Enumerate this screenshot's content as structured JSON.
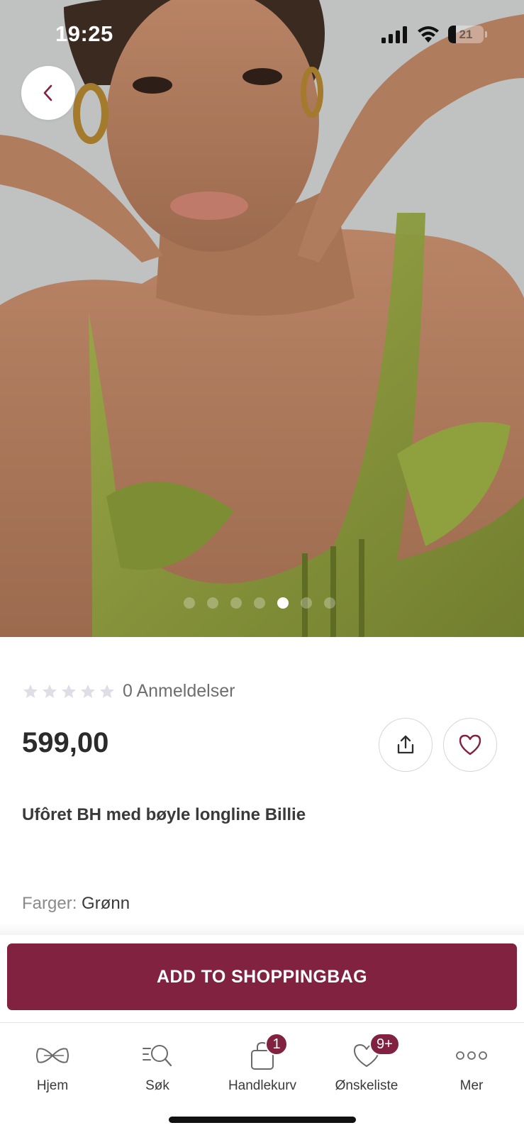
{
  "status_bar": {
    "time": "19:25",
    "battery_percent": "21",
    "icons": [
      "signal-icon",
      "wifi-icon",
      "battery-icon"
    ]
  },
  "gallery": {
    "image_count": 7,
    "active_index": 4,
    "back_icon": "chevron-left-icon"
  },
  "product": {
    "rating_stars": 0,
    "reviews_label": "0 Anmeldelser",
    "price": "599,00",
    "title": "Ufôret BH med bøyle longline Billie",
    "colors_label": "Farger:",
    "colors_value": "Grønn",
    "share_icon": "share-icon",
    "wishlist_icon": "heart-icon"
  },
  "actions": {
    "add_to_bag": "ADD TO SHOPPINGBAG"
  },
  "tabbar": {
    "items": [
      {
        "label": "Hjem",
        "icon": "bow-icon"
      },
      {
        "label": "Søk",
        "icon": "search-icon"
      },
      {
        "label": "Handlekurv",
        "icon": "shopping-bag-icon",
        "badge": "1"
      },
      {
        "label": "Ønskeliste",
        "icon": "heart-icon",
        "badge": "9+"
      },
      {
        "label": "Mer",
        "icon": "more-icon"
      }
    ]
  },
  "colors": {
    "brand": "#812240",
    "product_green": "#8a9a3c"
  }
}
